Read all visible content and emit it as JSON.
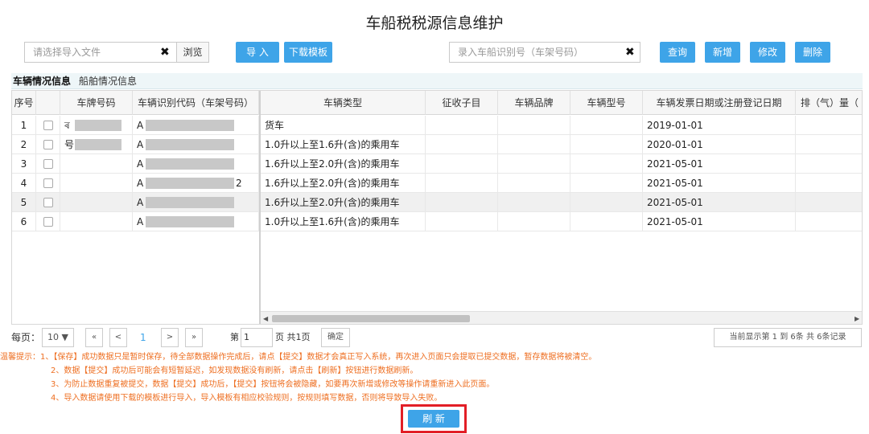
{
  "title": "车船税税源信息维护",
  "toolbar": {
    "file_placeholder": "请选择导入文件",
    "clear_symbol": "✖",
    "browse_label": "浏览",
    "import_label": "导 入",
    "download_label": "下载模板",
    "vin_placeholder": "录入车船识别号（车架号码）",
    "query_label": "查询",
    "add_label": "新增",
    "edit_label": "修改",
    "delete_label": "删除"
  },
  "tabs": [
    "车辆情况信息",
    "船舶情况信息"
  ],
  "table": {
    "headers": [
      "序号",
      "",
      "车牌号码",
      "车辆识别代码（车架号码）",
      "车辆类型",
      "征收子目",
      "车辆品牌",
      "车辆型号",
      "车辆发票日期或注册登记日期",
      "排（气）量（"
    ],
    "rows": [
      {
        "no": "1",
        "plate": "ৰ",
        "vin": "A",
        "vin_tail": "",
        "type": "货车",
        "date": "2019-01-01"
      },
      {
        "no": "2",
        "plate": "号",
        "vin": "A",
        "vin_tail": "",
        "type": "1.0升以上至1.6升(含)的乘用车",
        "date": "2020-01-01"
      },
      {
        "no": "3",
        "plate": "",
        "vin": "A",
        "vin_tail": "",
        "type": "1.6升以上至2.0升(含)的乘用车",
        "date": "2021-05-01"
      },
      {
        "no": "4",
        "plate": "",
        "vin": "A",
        "vin_tail": "2",
        "type": "1.6升以上至2.0升(含)的乘用车",
        "date": "2021-05-01"
      },
      {
        "no": "5",
        "plate": "",
        "vin": "A",
        "vin_tail": "",
        "type": "1.6升以上至2.0升(含)的乘用车",
        "date": "2021-05-01"
      },
      {
        "no": "6",
        "plate": "",
        "vin": "A",
        "vin_tail": "",
        "type": "1.0升以上至1.6升(含)的乘用车",
        "date": "2021-05-01"
      }
    ]
  },
  "pager": {
    "per_page_label": "每页：",
    "per_page_value": "10 ▼",
    "first": "«",
    "prev": "<",
    "current": "1",
    "next": ">",
    "last": "»",
    "page_prefix": "第",
    "page_value": "1",
    "page_suffix": "页 共1页",
    "confirm": "确定",
    "summary": "当前显示第  1 到  6条 共  6条记录"
  },
  "notes": [
    "温馨提示：1、【保存】成功数据只是暂时保存，待全部数据操作完成后，请点【提交】数据才会真正写入系统，再次进入页面只会提取已提交数据，暂存数据将被清空。",
    "2、数据【提交】成功后可能会有短暂延迟，如发现数据没有刷新，请点击【刷新】按钮进行数据刷新。",
    "3、为防止数据重复被提交，数据【提交】成功后，【提交】按钮将会被隐藏，如要再次新增或修改等操作请重新进入此页面。",
    "4、导入数据请使用下载的模板进行导入，导入模板有相应校验规则，按规则填写数据，否则将导致导入失败。"
  ],
  "refresh_label": "刷 新",
  "colors": {
    "accent": "#3ea4e8",
    "note": "#ee6f22",
    "highlight": "#e21e26"
  }
}
